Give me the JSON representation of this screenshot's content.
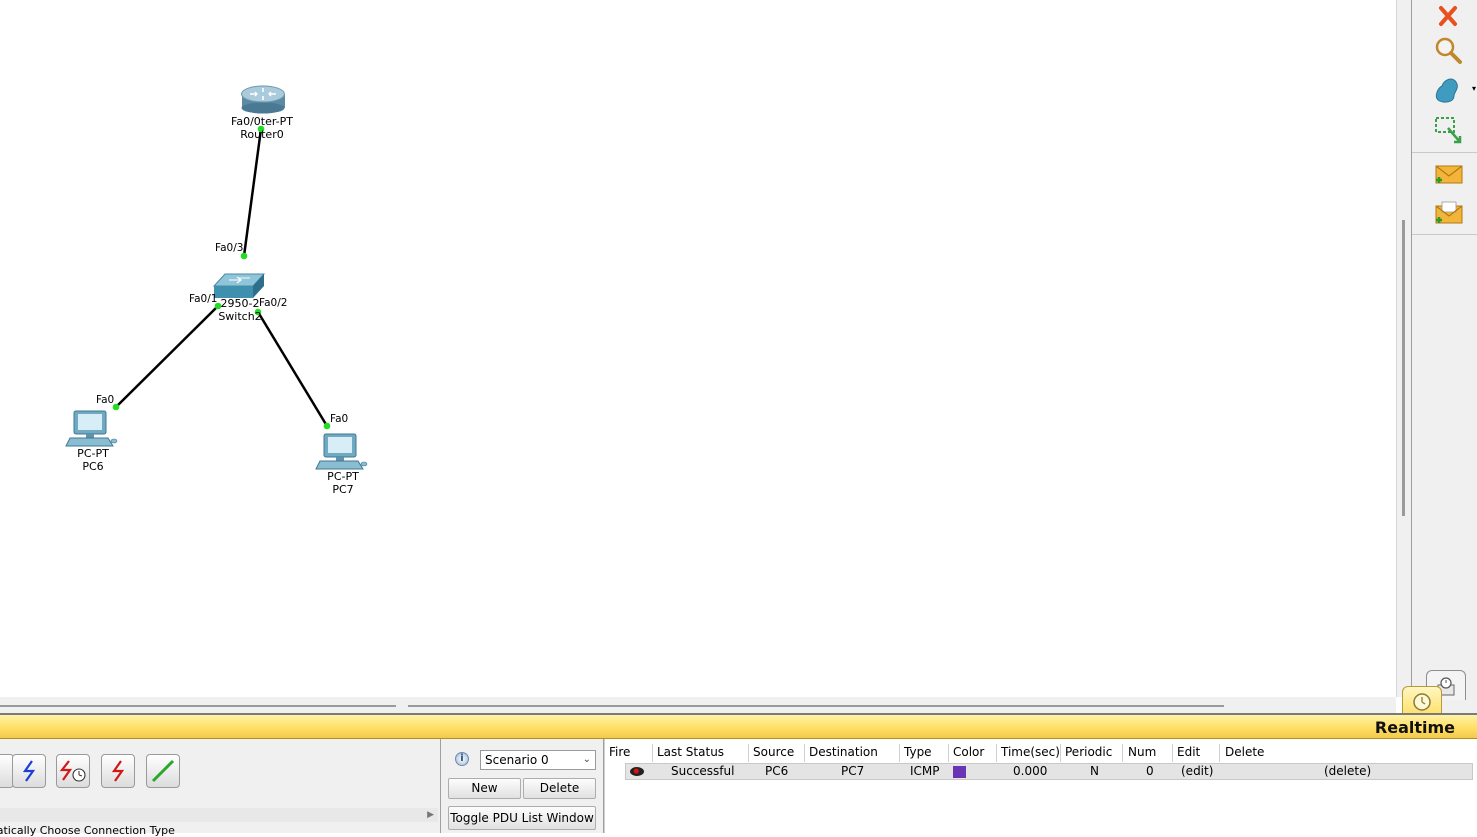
{
  "topology": {
    "devices": [
      {
        "id": "router0",
        "model": "Router-PT",
        "name": "Router0",
        "overlap_label": "Fa0/0ter-PT"
      },
      {
        "id": "switch2",
        "model": "2950-2",
        "name": "Switch2",
        "overlap_label": "2950-2"
      },
      {
        "id": "pc6",
        "model": "PC-PT",
        "name": "PC6"
      },
      {
        "id": "pc7",
        "model": "PC-PT",
        "name": "PC7"
      }
    ],
    "ports": {
      "switch_fa03": "Fa0/3",
      "switch_fa01": "Fa0/1",
      "switch_fa02": "Fa0/2",
      "pc6_fa0": "Fa0",
      "pc7_fa0": "Fa0"
    },
    "link_status_color": "#22dd22",
    "cable_color": "#000000"
  },
  "right_toolbar": {
    "tools": [
      "delete-icon",
      "inspect-icon",
      "draw-shape-icon",
      "resize-shape-icon",
      "add-simple-pdu-icon",
      "add-complex-pdu-icon"
    ],
    "delete_color": "#e8501c"
  },
  "mode_bar": {
    "label": "Realtime",
    "bar_color": "#ffe066"
  },
  "connections": {
    "hint_text": "matically Choose Connection Type",
    "types": [
      "serial-dce-icon",
      "serial-dte-icon",
      "serial-clock-icon",
      "crossover-icon",
      "straight-through-icon"
    ]
  },
  "scenario": {
    "selected": "Scenario 0",
    "new_label": "New",
    "delete_label": "Delete",
    "toggle_label": "Toggle PDU List Window"
  },
  "pdu_list": {
    "columns": [
      "Fire",
      "Last Status",
      "Source",
      "Destination",
      "Type",
      "Color",
      "Time(sec)",
      "Periodic",
      "Num",
      "Edit",
      "Delete"
    ],
    "rows": [
      {
        "last_status": "Successful",
        "source": "PC6",
        "destination": "PC7",
        "type": "ICMP",
        "color": "#6a35b5",
        "time": "0.000",
        "periodic": "N",
        "num": "0",
        "edit": "(edit)",
        "delete": "(delete)"
      }
    ]
  }
}
